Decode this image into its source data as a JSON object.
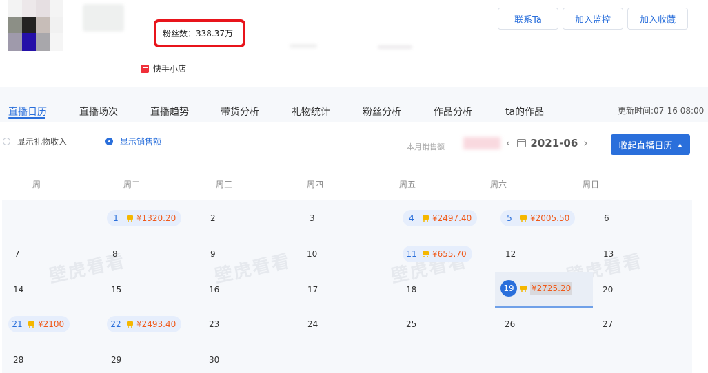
{
  "profile": {
    "fans_label": "粉丝数：338.37万",
    "shop_label": "快手小店"
  },
  "header_buttons": {
    "contact": "联系Ta",
    "monitor": "加入监控",
    "favorite": "加入收藏"
  },
  "tabs": [
    {
      "label": "直播日历",
      "active": true
    },
    {
      "label": "直播场次",
      "active": false
    },
    {
      "label": "直播趋势",
      "active": false
    },
    {
      "label": "带货分析",
      "active": false
    },
    {
      "label": "礼物统计",
      "active": false
    },
    {
      "label": "粉丝分析",
      "active": false
    },
    {
      "label": "作品分析",
      "active": false
    },
    {
      "label": "ta的作品",
      "active": false
    }
  ],
  "updated_time": "更新时间:07-16 08:00",
  "options": {
    "gift_income": "显示礼物收入",
    "sales": "显示销售额",
    "selected": "sales"
  },
  "month_sales_label": "本月销售额",
  "month": "2021-06",
  "collapse_button": "收起直播日历",
  "weekdays": [
    "周一",
    "周二",
    "周三",
    "周四",
    "周五",
    "周六",
    "周日"
  ],
  "calendar": {
    "cells": [
      {
        "day": "1",
        "amount": "¥1320.20"
      },
      {
        "day": "2"
      },
      {
        "day": "3"
      },
      {
        "day": "4",
        "amount": "¥2497.40"
      },
      {
        "day": "5",
        "amount": "¥2005.50"
      },
      {
        "day": "6"
      },
      {
        "day": "7"
      },
      {
        "day": "8"
      },
      {
        "day": "9"
      },
      {
        "day": "10"
      },
      {
        "day": "11",
        "amount": "¥655.70"
      },
      {
        "day": "12"
      },
      {
        "day": "13"
      },
      {
        "day": "14"
      },
      {
        "day": "15"
      },
      {
        "day": "16"
      },
      {
        "day": "17"
      },
      {
        "day": "18"
      },
      {
        "day": "19",
        "amount": "¥2725.20",
        "selected": true
      },
      {
        "day": "20"
      },
      {
        "day": "21",
        "amount": "¥2100"
      },
      {
        "day": "22",
        "amount": "¥2493.40"
      },
      {
        "day": "23"
      },
      {
        "day": "24"
      },
      {
        "day": "25"
      },
      {
        "day": "26"
      },
      {
        "day": "27"
      },
      {
        "day": "28"
      },
      {
        "day": "29"
      },
      {
        "day": "30"
      }
    ]
  },
  "watermark": "壁虎看看",
  "colors": {
    "accent": "#2a6fdb",
    "amount": "#f05a1a",
    "highlight_border": "#e8141b"
  }
}
